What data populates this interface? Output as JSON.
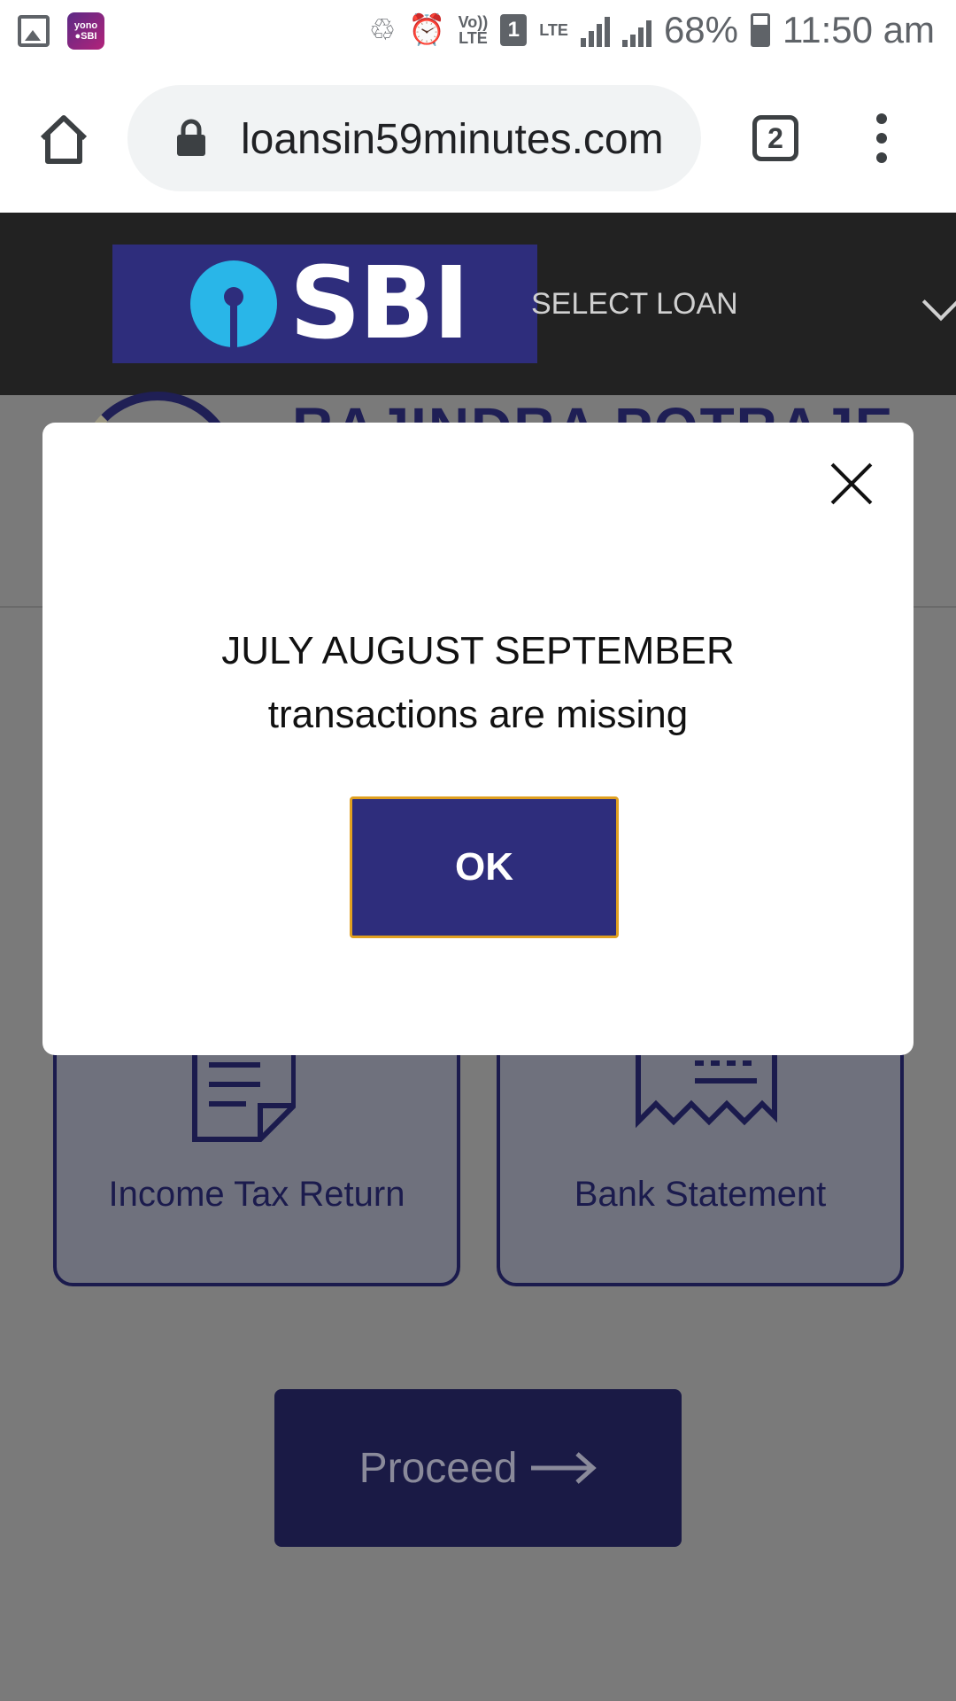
{
  "status_bar": {
    "notification_icons": [
      "gallery-icon",
      "yono-sbi-icon"
    ],
    "yono_line1": "yono",
    "yono_line2": "●SBI",
    "volte_top": "Vo))",
    "volte_bottom": "LTE",
    "sim_number": "1",
    "lte": "LTE",
    "battery_percent": "68%",
    "time": "11:50 am"
  },
  "browser": {
    "url": "loansin59minutes.com",
    "tab_count": "2"
  },
  "header": {
    "logo_text": "SBI",
    "select_loan": "SELECT LOAN"
  },
  "background": {
    "profile_name": "RAJINDRA POTRAJE",
    "cards": [
      {
        "label": "Income Tax Return"
      },
      {
        "label": "Bank Statement"
      }
    ],
    "proceed_label": "Proceed"
  },
  "modal": {
    "message_line1": "JULY AUGUST SEPTEMBER",
    "message_line2": "transactions are missing",
    "ok_label": "OK"
  },
  "colors": {
    "sbi_blue": "#2e2d7c",
    "sbi_cyan": "#29b6e8",
    "header_dark": "#222222",
    "ok_border": "#e0a020"
  }
}
